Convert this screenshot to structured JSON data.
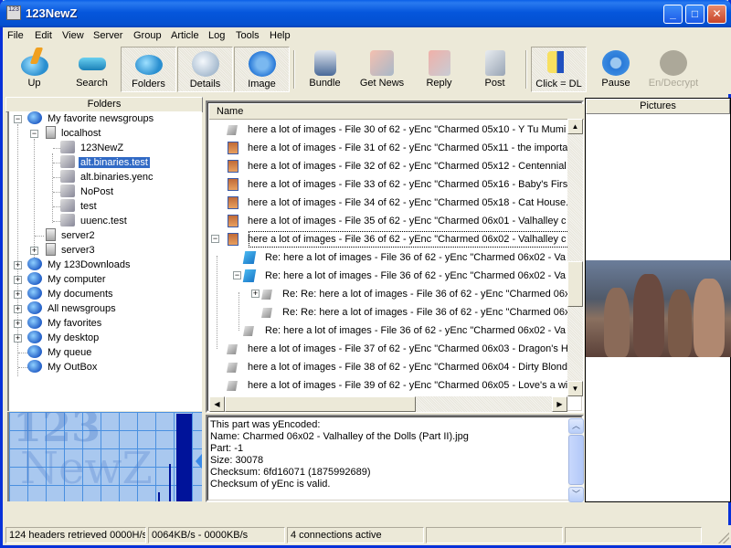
{
  "window": {
    "title": "123NewZ",
    "app_icon_text": "123"
  },
  "menu": [
    "File",
    "Edit",
    "View",
    "Server",
    "Group",
    "Article",
    "Log",
    "Tools",
    "Help"
  ],
  "toolbar": {
    "up": "Up",
    "search": "Search",
    "folders": "Folders",
    "details": "Details",
    "image": "Image",
    "bundle": "Bundle",
    "get_news": "Get News",
    "reply": "Reply",
    "post": "Post",
    "click_dl": "Click = DL",
    "pause": "Pause",
    "en_decrypt": "En/Decrypt"
  },
  "folders": {
    "header": "Folders",
    "tree": [
      {
        "label": "My favorite newsgroups",
        "icon": "globe-icon",
        "expanded": true
      },
      {
        "label": "localhost",
        "icon": "server-icon",
        "expanded": true
      },
      {
        "label": "123NewZ",
        "icon": "newsgroup-icon"
      },
      {
        "label": "alt.binaries.test",
        "icon": "newsgroup-active-icon",
        "selected": true
      },
      {
        "label": "alt.binaries.yenc",
        "icon": "newsgroup-icon"
      },
      {
        "label": "NoPost",
        "icon": "newsgroup-icon"
      },
      {
        "label": "test",
        "icon": "newsgroup-icon"
      },
      {
        "label": "uuenc.test",
        "icon": "newsgroup-icon"
      },
      {
        "label": "server2",
        "icon": "server-icon"
      },
      {
        "label": "server3",
        "icon": "server-icon",
        "expanded": false
      },
      {
        "label": "My 123Downloads",
        "icon": "globe-icon",
        "expanded": false
      },
      {
        "label": "My computer",
        "icon": "globe-icon",
        "expanded": false
      },
      {
        "label": "My documents",
        "icon": "globe-icon",
        "expanded": false
      },
      {
        "label": "All newsgroups",
        "icon": "globe-icon",
        "expanded": false
      },
      {
        "label": "My favorites",
        "icon": "globe-icon",
        "expanded": false
      },
      {
        "label": "My desktop",
        "icon": "globe-icon",
        "expanded": false
      },
      {
        "label": "My queue",
        "icon": "globe-icon"
      },
      {
        "label": "My OutBox",
        "icon": "globe-icon"
      }
    ],
    "banner_text_1": "123",
    "banner_text_2": "NewZ"
  },
  "messages": {
    "column_header": "Name",
    "rows": [
      {
        "label": "here a lot of images - File 30 of 62 - yEnc \"Charmed 05x10 - Y Tu Mumi",
        "icon": "grey",
        "level": 0
      },
      {
        "label": "here a lot of images - File 31 of 62 - yEnc \"Charmed 05x11 - the importa",
        "icon": "img",
        "level": 0
      },
      {
        "label": "here a lot of images - File 32 of 62 - yEnc \"Charmed 05x12 - Centennial",
        "icon": "img",
        "level": 0
      },
      {
        "label": "here a lot of images - File 33 of 62 - yEnc \"Charmed 05x16 - Baby's First",
        "icon": "img",
        "level": 0
      },
      {
        "label": "here a lot of images - File 34 of 62 - yEnc \"Charmed 05x18 - Cat House.",
        "icon": "img",
        "level": 0
      },
      {
        "label": "here a lot of images - File 35 of 62 - yEnc \"Charmed 06x01 - Valhalley c",
        "icon": "img",
        "level": 0
      },
      {
        "label": "here a lot of images - File 36 of 62 - yEnc \"Charmed 06x02 - Valhalley c",
        "icon": "img",
        "level": 0,
        "focused": true,
        "expanded": true
      },
      {
        "label": "Re: here a lot of images - File 36 of 62 - yEnc \"Charmed 06x02 - Va",
        "icon": "blue",
        "level": 1
      },
      {
        "label": "Re: here a lot of images - File 36 of 62 - yEnc \"Charmed 06x02 - Va",
        "icon": "blue",
        "level": 1,
        "expanded": true
      },
      {
        "label": "Re: Re: here a lot of images - File 36 of 62 - yEnc \"Charmed 06x",
        "icon": "grey",
        "level": 2,
        "expanded": false
      },
      {
        "label": "Re: Re: here a lot of images - File 36 of 62 - yEnc \"Charmed 06x",
        "icon": "grey",
        "level": 2
      },
      {
        "label": "Re: here a lot of images - File 36 of 62 - yEnc \"Charmed 06x02 - Va",
        "icon": "grey",
        "level": 1
      },
      {
        "label": "here a lot of images - File 37 of 62 - yEnc \"Charmed 06x03 - Dragon's H",
        "icon": "grey",
        "level": 0
      },
      {
        "label": "here a lot of images - File 38 of 62 - yEnc \"Charmed 06x04 - Dirty Blond",
        "icon": "grey",
        "level": 0
      },
      {
        "label": "here a lot of images - File 39 of 62 - yEnc \"Charmed 06x05 - Love's a wi",
        "icon": "grey",
        "level": 0
      }
    ]
  },
  "preview": {
    "lines": [
      "This part was yEncoded:",
      "Name: Charmed 06x02 - Valhalley of the Dolls (Part II).jpg",
      "Part: -1",
      "Size: 30078",
      "Checksum: 6fd16071 (1875992689)",
      "Checksum of yEnc is valid."
    ]
  },
  "pictures": {
    "header": "Pictures"
  },
  "statusbar": {
    "headers": "124 headers retrieved 0000H/s",
    "speed": "0064KB/s  -  0000KB/s",
    "connections": "4 connections active",
    "panel4": "",
    "panel5": ""
  }
}
